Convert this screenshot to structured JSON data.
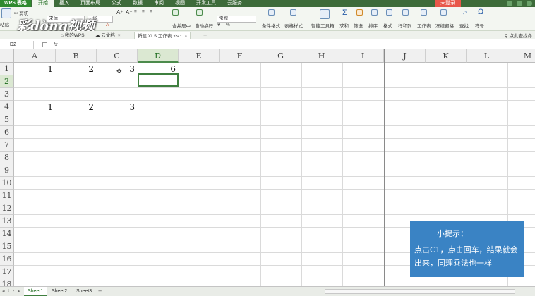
{
  "app": {
    "logo": "WPS 表格",
    "unlogged_label": "未登录"
  },
  "menu_tabs": [
    "开始",
    "插入",
    "页面布局",
    "公式",
    "数据",
    "审阅",
    "视图",
    "开发工具",
    "云服务"
  ],
  "ribbon": {
    "cut": "剪切",
    "paste": "粘贴",
    "font_name": "宋体",
    "font_size": "12",
    "merge_center": "合并居中",
    "wrap_text": "自动换行",
    "number_format": "常规",
    "cond_format": "条件格式",
    "table_style": "表格样式",
    "smart_toolbox": "智能工具箱",
    "sum": "求和",
    "filter": "筛选",
    "sort": "排序",
    "format": "格式",
    "row_col": "行和列",
    "worksheet": "工作表",
    "freeze": "冻结窗格",
    "find": "查找",
    "symbol": "符号",
    "percent": "%"
  },
  "watermark": "彩dòng视频",
  "doc_tabs": {
    "my_wps": "我的WPS",
    "cloud_docs": "云文档",
    "active_file": "新建 XLS 工作表.xls *",
    "search_hint": "点此查找命"
  },
  "formula_bar": {
    "cell_ref": "D2",
    "fx": "fx",
    "content": ""
  },
  "grid": {
    "columns": [
      "A",
      "B",
      "C",
      "D",
      "E",
      "F",
      "G",
      "H",
      "I",
      "J",
      "K",
      "L",
      "M"
    ],
    "rows": [
      "1",
      "2",
      "3",
      "4",
      "5",
      "6",
      "7",
      "8",
      "9",
      "10",
      "11",
      "12",
      "13",
      "14",
      "15",
      "16",
      "17",
      "18"
    ],
    "selected_col": "D",
    "selected_row": "2",
    "row1": {
      "A": "1",
      "B": "2",
      "C": "3",
      "D": "6"
    },
    "row4": {
      "A": "1",
      "B": "2",
      "C": "3"
    }
  },
  "tip": {
    "title": "小提示：",
    "lines": [
      "点击C1，点击回车，结果就会",
      "出来，同理乘法也一样"
    ]
  },
  "sheets": [
    "Sheet1",
    "Sheet2",
    "Sheet3"
  ],
  "add_sheet": "+"
}
